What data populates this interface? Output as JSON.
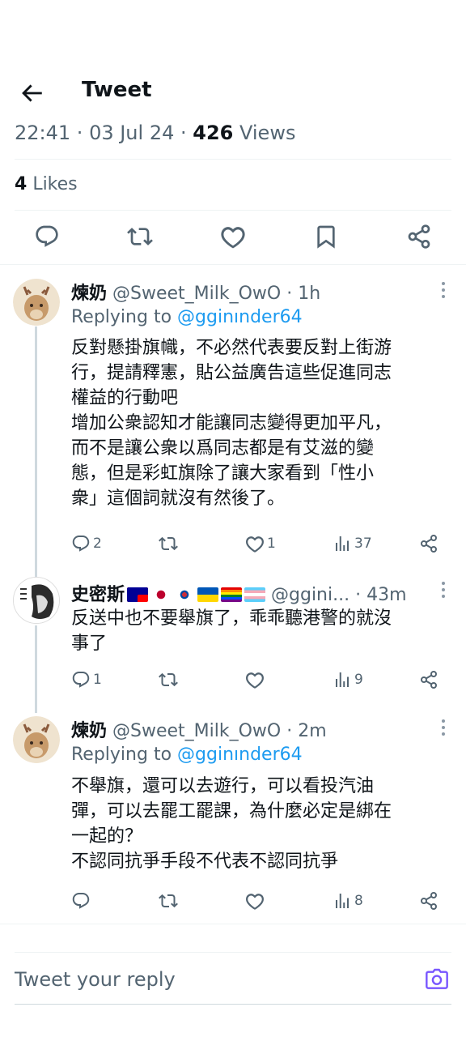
{
  "header": {
    "title": "Tweet"
  },
  "meta": {
    "time": "22:41",
    "date": "03 Jul 24",
    "views_count": "426",
    "views_label": "Views"
  },
  "likes": {
    "count": "4",
    "label": "Likes"
  },
  "tweets": [
    {
      "name": "煉奶",
      "handle": "@Sweet_Milk_OwO",
      "time": "1h",
      "replying_prefix": "Replying to",
      "replying_to": "@gginınder64",
      "text": "反對懸掛旗幟，不必然代表要反對上街游\n行，提請釋憲，貼公益廣告這些促進同志\n權益的行動吧\n增加公衆認知才能讓同志變得更加平凡，\n而不是讓公衆以爲同志都是有艾滋的變\n態，但是彩虹旗除了讓大家看到「性小\n衆」這個詞就沒有然後了。",
      "replies": "2",
      "retweets": "",
      "likes": "1",
      "views": "37"
    },
    {
      "name": "史密斯",
      "handle": "@ggini...",
      "time": "43m",
      "text": "反送中也不要舉旗了，乖乖聽港警的就沒\n事了",
      "replies": "1",
      "retweets": "",
      "likes": "",
      "views": "9"
    },
    {
      "name": "煉奶",
      "handle": "@Sweet_Milk_OwO",
      "time": "2m",
      "replying_prefix": "Replying to",
      "replying_to": "@gginınder64",
      "text": "不舉旗，還可以去遊行，可以看投汽油\n彈，可以去罷工罷課，為什麼必定是綁在\n一起的？\n不認同抗爭手段不代表不認同抗爭",
      "replies": "",
      "retweets": "",
      "likes": "",
      "views": "8"
    }
  ],
  "reply_bar": {
    "placeholder": "Tweet your reply"
  },
  "colors": {
    "accent": "#1d9bf0",
    "secondary": "#536471",
    "text": "#0f1419"
  },
  "icons": [
    "back-arrow-icon",
    "reply-icon",
    "retweet-icon",
    "like-icon",
    "bookmark-icon",
    "share-icon",
    "views-icon",
    "more-icon",
    "camera-icon"
  ]
}
